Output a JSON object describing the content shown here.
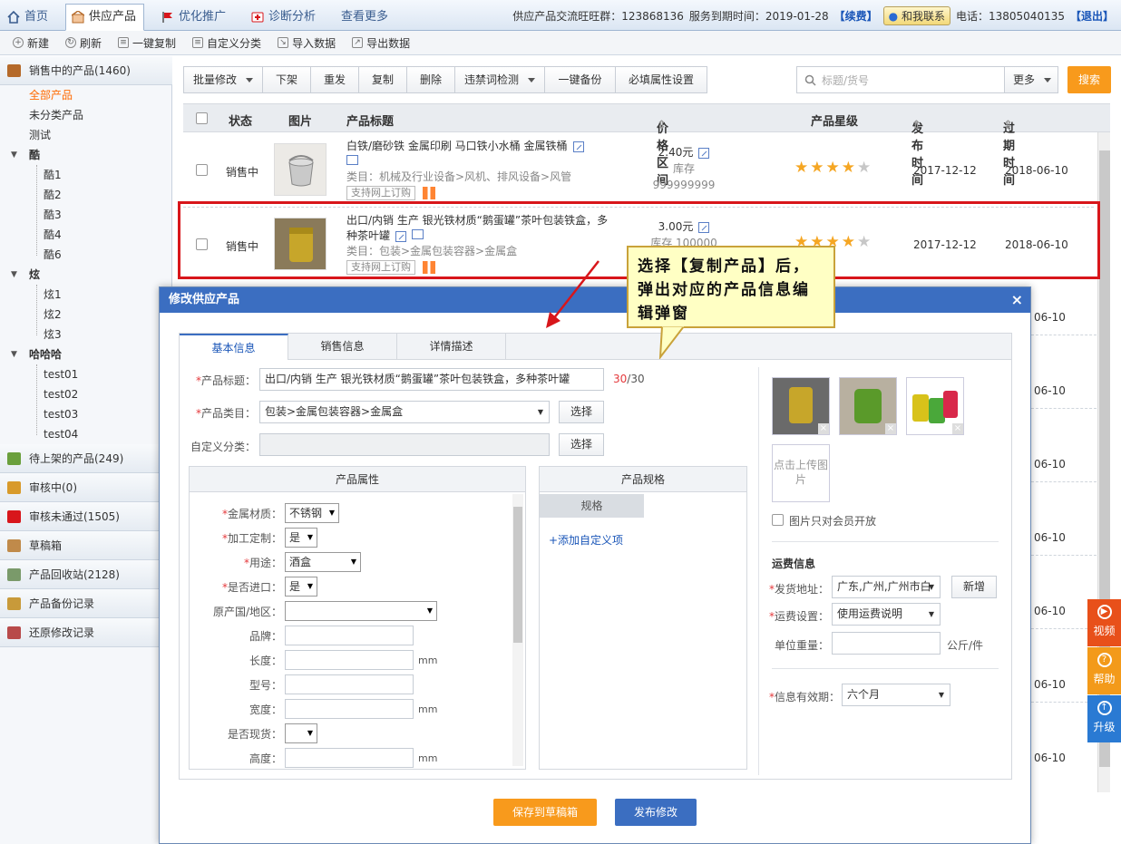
{
  "topnav": {
    "tabs": [
      {
        "label": "首页",
        "icon": "home-icon"
      },
      {
        "label": "供应产品",
        "icon": "shop-icon",
        "active": true
      },
      {
        "label": "优化推广",
        "icon": "flag-icon"
      },
      {
        "label": "诊断分析",
        "icon": "medical-icon"
      },
      {
        "label": "查看更多"
      }
    ],
    "group_text": "供应产品交流旺旺群：123868136",
    "expire_text": "服务到期时间：2019-01-28",
    "renew": "【续费】",
    "contact_btn": "和我联系",
    "phone": "电话：13805040135",
    "logout": "【退出】"
  },
  "toolbar": {
    "items": [
      "新建",
      "刷新",
      "一键复制",
      "自定义分类",
      "导入数据",
      "导出数据"
    ]
  },
  "sidebar": {
    "section_selling": "销售中的产品(1460)",
    "all_products": "全部产品",
    "uncategorized": "未分类产品",
    "test": "测试",
    "group_ku": "酷",
    "ku_items": [
      "酷1",
      "酷2",
      "酷3",
      "酷4",
      "酷6"
    ],
    "group_xuan": "炫",
    "xuan_items": [
      "炫1",
      "炫2",
      "炫3"
    ],
    "group_hhh": "哈哈哈",
    "hhh_items": [
      "test01",
      "test02",
      "test03",
      "test04"
    ],
    "sections": [
      "待上架的产品(249)",
      "审核中(0)",
      "审核未通过(1505)",
      "草稿箱",
      "产品回收站(2128)",
      "产品备份记录",
      "还原修改记录"
    ]
  },
  "actions": {
    "batch_edit": "批量修改",
    "offline": "下架",
    "repost": "重发",
    "copy": "复制",
    "delete": "删除",
    "banned_check": "违禁词检测",
    "backup": "一键备份",
    "attr_setting": "必填属性设置",
    "search_placeholder": "标题/货号",
    "more": "更多",
    "search": "搜索"
  },
  "table": {
    "headers": {
      "status": "状态",
      "image": "图片",
      "title": "产品标题",
      "price": "价格区间",
      "stars": "产品星级",
      "publish": "发布时间",
      "expire": "过期时间"
    },
    "rows": [
      {
        "status": "销售中",
        "title": "白铁/磨砂铁 金属印刷 马口铁小水桶 金属铁桶",
        "category": "类目：机械及行业设备>风机、排风设备>风管",
        "tag": "支持网上订购",
        "price": "2.40元",
        "stock": "库存 999999999",
        "stars": 4,
        "publish": "2017-12-12",
        "expire": "2018-06-10"
      },
      {
        "status": "销售中",
        "title": "出口/内销 生产 银光铁材质“鹅蛋罐”茶叶包装铁盒，多种茶叶罐",
        "category": "类目：包装>金属包装容器>金属盒",
        "tag": "支持网上订购",
        "price": "3.00元",
        "stock": "库存 100000",
        "stars": 4,
        "publish": "2017-12-12",
        "expire": "2018-06-10"
      }
    ],
    "partial_dates": [
      "06-10",
      "06-10",
      "06-10",
      "06-10",
      "06-10",
      "06-10",
      "06-10"
    ]
  },
  "callout": {
    "text": "选择【复制产品】后，弹出对应的产品信息编辑弹窗"
  },
  "modal": {
    "title": "修改供应产品",
    "close": "×",
    "tabs": [
      "基本信息",
      "销售信息",
      "详情描述"
    ],
    "title_label": "产品标题：",
    "title_value": "出口/内销 生产 银光铁材质“鹅蛋罐”茶叶包装铁盒，多种茶叶罐",
    "title_count": "30",
    "title_max": "/30",
    "category_label": "产品类目：",
    "category_value": "包装>金属包装容器>金属盒",
    "choose": "选择",
    "custom_label": "自定义分类：",
    "attr_panel": "产品属性",
    "spec_panel": "产品规格",
    "spec_tab": "规格",
    "add_custom": "+添加自定义项",
    "attrs": [
      {
        "label": "金属材质：",
        "value": "不锈钢",
        "req": true
      },
      {
        "label": "加工定制：",
        "value": "是",
        "req": true
      },
      {
        "label": "用途：",
        "value": "酒盒",
        "req": true
      },
      {
        "label": "是否进口：",
        "value": "是",
        "req": true
      },
      {
        "label": "原产国/地区：",
        "value": ""
      },
      {
        "label": "品牌：",
        "value": ""
      },
      {
        "label": "长度：",
        "value": "",
        "unit": "mm"
      },
      {
        "label": "型号：",
        "value": ""
      },
      {
        "label": "宽度：",
        "value": "",
        "unit": "mm"
      },
      {
        "label": "是否现货：",
        "value": ""
      },
      {
        "label": "高度：",
        "value": "",
        "unit": "mm"
      }
    ],
    "upload": "点击上传图片",
    "members_only": "图片只对会员开放",
    "shipping_title": "运费信息",
    "ship_addr_label": "发货地址：",
    "ship_addr_value": "广东,广州,广州市白",
    "new_btn": "新增",
    "ship_setting_label": "运费设置：",
    "ship_setting_value": "使用运费说明",
    "weight_label": "单位重量：",
    "weight_unit": "公斤/件",
    "validity_label": "信息有效期：",
    "validity_value": "六个月",
    "save_draft": "保存到草稿箱",
    "publish": "发布修改"
  },
  "floating": {
    "video": "视频",
    "help": "帮助",
    "upgrade": "升级"
  },
  "colors": {
    "accent_blue": "#3b6ec1",
    "orange": "#f89a1c",
    "highlight_red": "#d8161b"
  }
}
